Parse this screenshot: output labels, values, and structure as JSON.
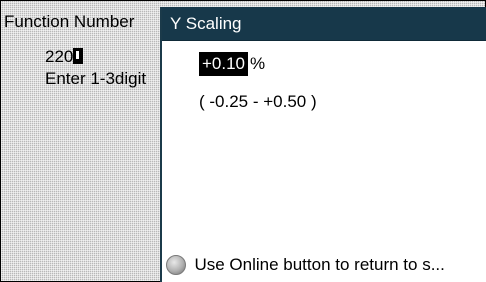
{
  "background_panel": {
    "title": "Function Number",
    "value": "220",
    "hint": "Enter 1-3digit"
  },
  "dialog": {
    "title": "Y Scaling",
    "value": "+0.10",
    "unit": "%",
    "range": "( -0.25 - +0.50 )",
    "footer_text": "Use Online button to return to s..."
  },
  "icons": {
    "online": "online-button-icon",
    "cursor": "enter-cursor-icon"
  },
  "colors": {
    "titlebar": "#17384a",
    "value_highlight": "#000000"
  }
}
